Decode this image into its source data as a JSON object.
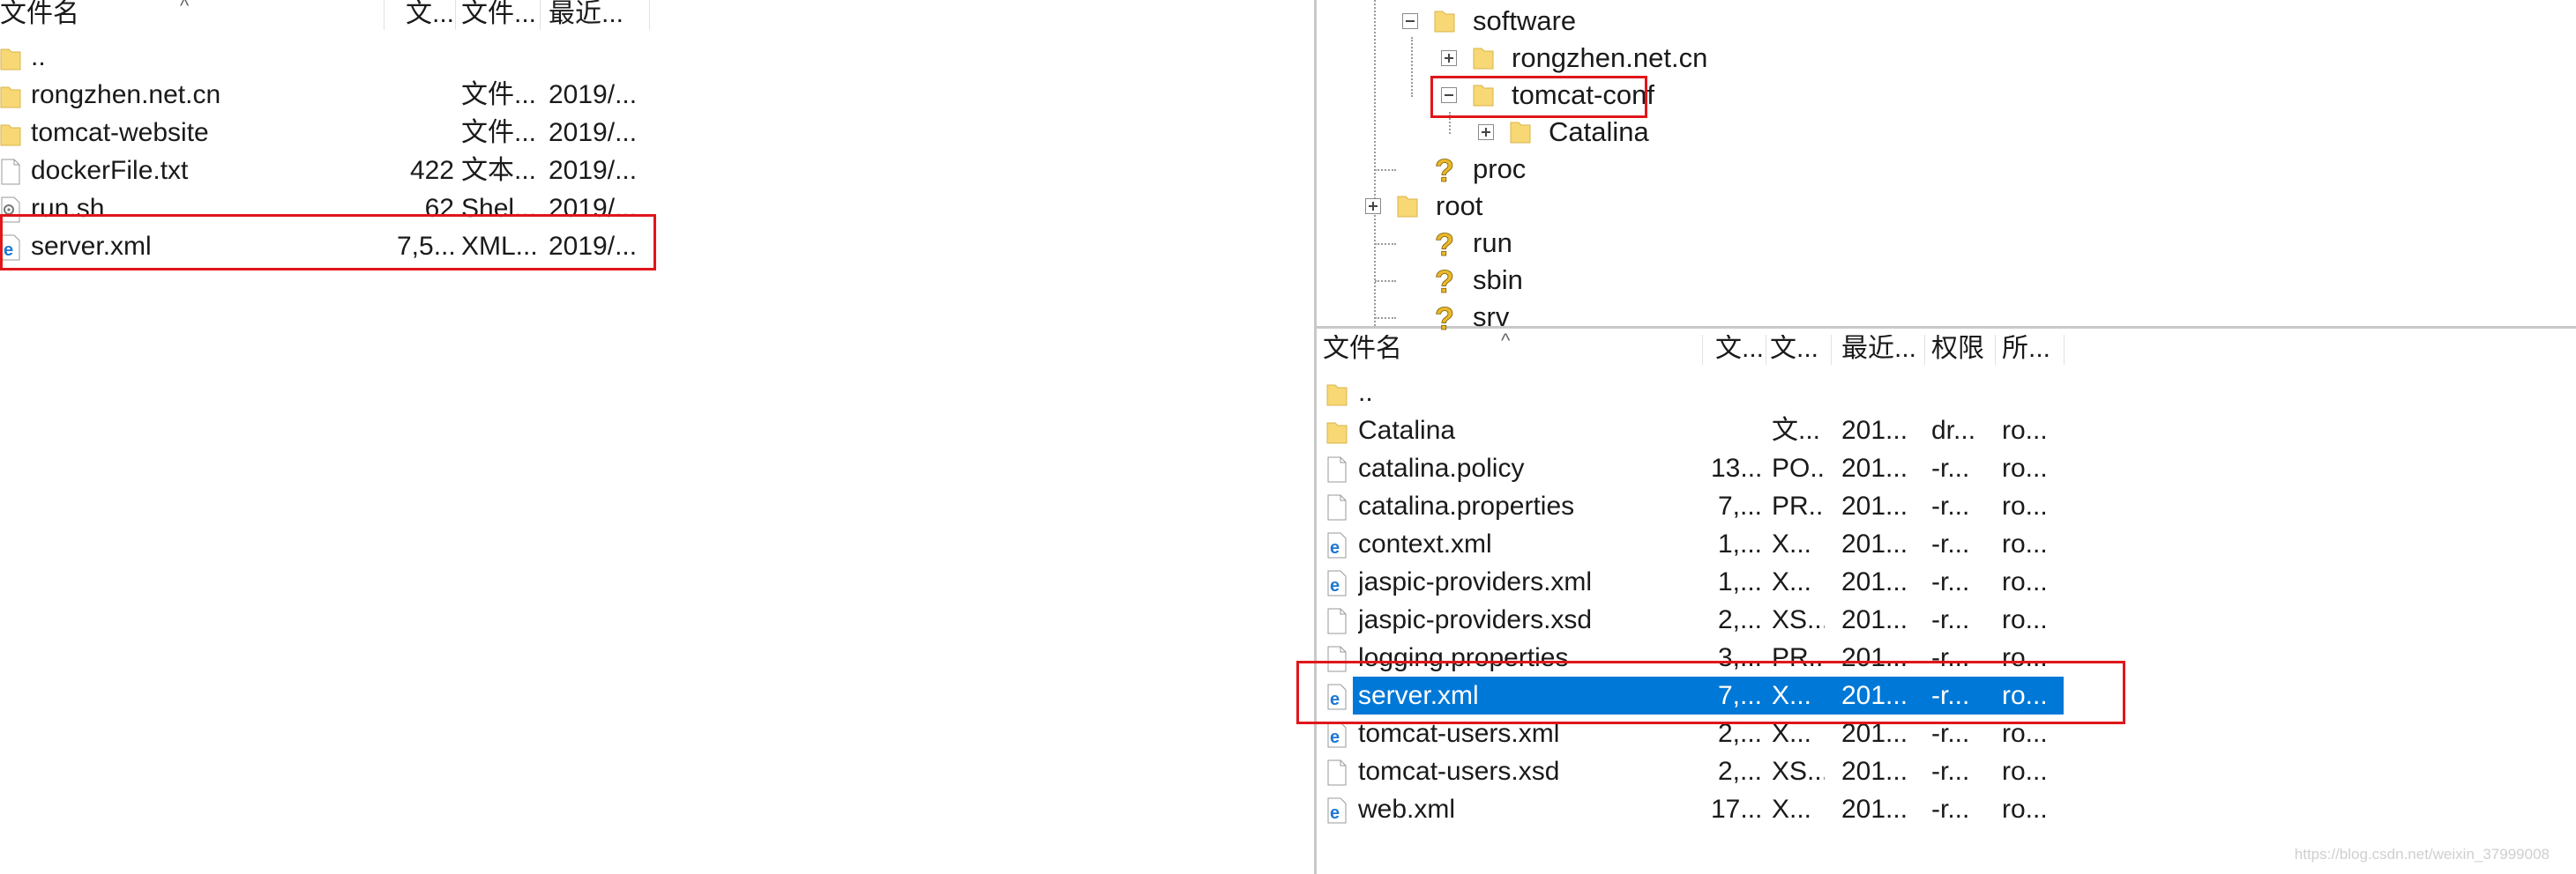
{
  "left_pane": {
    "columns": [
      "文件名",
      "文...",
      "文件...",
      "最近..."
    ],
    "rows": [
      {
        "name": "..",
        "size": "",
        "type": "",
        "date": "",
        "icon": "folder-icon"
      },
      {
        "name": "rongzhen.net.cn",
        "size": "",
        "type": "文件...",
        "date": "2019/...",
        "icon": "folder-icon"
      },
      {
        "name": "tomcat-website",
        "size": "",
        "type": "文件...",
        "date": "2019/...",
        "icon": "folder-icon"
      },
      {
        "name": "dockerFile.txt",
        "size": "422",
        "type": "文本...",
        "date": "2019/...",
        "icon": "text-file-icon"
      },
      {
        "name": "run.sh",
        "size": "62",
        "type": "Shel...",
        "date": "2019/...",
        "icon": "shell-script-icon"
      },
      {
        "name": "server.xml",
        "size": "7,5...",
        "type": "XML...",
        "date": "2019/...",
        "icon": "xml-file-icon"
      }
    ]
  },
  "tree": {
    "nodes": [
      {
        "label": "software",
        "expander": "minus",
        "icon": "folder-icon"
      },
      {
        "label": "rongzhen.net.cn",
        "expander": "plus",
        "icon": "folder-icon"
      },
      {
        "label": "tomcat-conf",
        "expander": "minus",
        "icon": "folder-icon"
      },
      {
        "label": "Catalina",
        "expander": "plus",
        "icon": "folder-icon"
      },
      {
        "label": "proc",
        "expander": "",
        "icon": "unknown-folder-icon"
      },
      {
        "label": "root",
        "expander": "plus",
        "icon": "folder-icon"
      },
      {
        "label": "run",
        "expander": "",
        "icon": "unknown-folder-icon"
      },
      {
        "label": "sbin",
        "expander": "",
        "icon": "unknown-folder-icon"
      },
      {
        "label": "srv",
        "expander": "",
        "icon": "unknown-folder-icon"
      }
    ]
  },
  "right_pane": {
    "columns": [
      "文件名",
      "文...",
      "文...",
      "最近...",
      "权限",
      "所..."
    ],
    "rows": [
      {
        "name": "..",
        "size": "",
        "type": "",
        "date": "",
        "perm": "",
        "owner": "",
        "icon": "folder-icon"
      },
      {
        "name": "Catalina",
        "size": "",
        "type": "文...",
        "date": "201...",
        "perm": "dr...",
        "owner": "ro...",
        "icon": "folder-icon"
      },
      {
        "name": "catalina.policy",
        "size": "13...",
        "type": "PO...",
        "date": "201...",
        "perm": "-r...",
        "owner": "ro...",
        "icon": "text-file-icon"
      },
      {
        "name": "catalina.properties",
        "size": "7,...",
        "type": "PR...",
        "date": "201...",
        "perm": "-r...",
        "owner": "ro...",
        "icon": "text-file-icon"
      },
      {
        "name": "context.xml",
        "size": "1,...",
        "type": "X...",
        "date": "201...",
        "perm": "-r...",
        "owner": "ro...",
        "icon": "xml-file-icon"
      },
      {
        "name": "jaspic-providers.xml",
        "size": "1,...",
        "type": "X...",
        "date": "201...",
        "perm": "-r...",
        "owner": "ro...",
        "icon": "xml-file-icon"
      },
      {
        "name": "jaspic-providers.xsd",
        "size": "2,...",
        "type": "XS...",
        "date": "201...",
        "perm": "-r...",
        "owner": "ro...",
        "icon": "text-file-icon"
      },
      {
        "name": "logging.properties",
        "size": "3,...",
        "type": "PR...",
        "date": "201...",
        "perm": "-r...",
        "owner": "ro...",
        "icon": "text-file-icon"
      },
      {
        "name": "server.xml",
        "size": "7,...",
        "type": "X...",
        "date": "201...",
        "perm": "-r...",
        "owner": "ro...",
        "icon": "xml-file-icon"
      },
      {
        "name": "tomcat-users.xml",
        "size": "2,...",
        "type": "X...",
        "date": "201...",
        "perm": "-r...",
        "owner": "ro...",
        "icon": "xml-file-icon"
      },
      {
        "name": "tomcat-users.xsd",
        "size": "2,...",
        "type": "XS...",
        "date": "201...",
        "perm": "-r...",
        "owner": "ro...",
        "icon": "text-file-icon"
      },
      {
        "name": "web.xml",
        "size": "17...",
        "type": "X...",
        "date": "201...",
        "perm": "-r...",
        "owner": "ro...",
        "icon": "xml-file-icon"
      }
    ]
  },
  "selected_row_name": "server.xml",
  "watermark": "https://blog.csdn.net/weixin_37999008",
  "colors": {
    "selection": "#0078d7",
    "highlight_box": "#e0161b",
    "folder": "#f8d775"
  }
}
